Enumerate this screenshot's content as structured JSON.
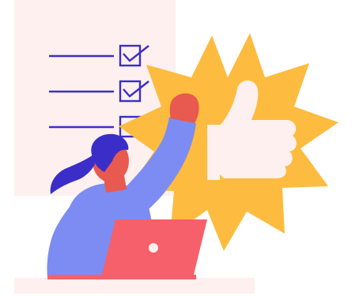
{
  "illustration": {
    "checklist": {
      "items": [
        {
          "checked": true
        },
        {
          "checked": true
        },
        {
          "checked": true
        }
      ]
    },
    "badge": {
      "icon": "thumbs-up-icon"
    },
    "laptop": {
      "icon": "laptop-icon"
    },
    "colors": {
      "paper": "#fdf0ee",
      "line": "#3b2ec8",
      "burst": "#fdbc3f",
      "thumb": "#fdf0ee",
      "skin": "#e8594f",
      "hair": "#3b2ec8",
      "shirt": "#7d8cf2",
      "laptop": "#f6606a",
      "desk": "#fdf0ee"
    }
  }
}
